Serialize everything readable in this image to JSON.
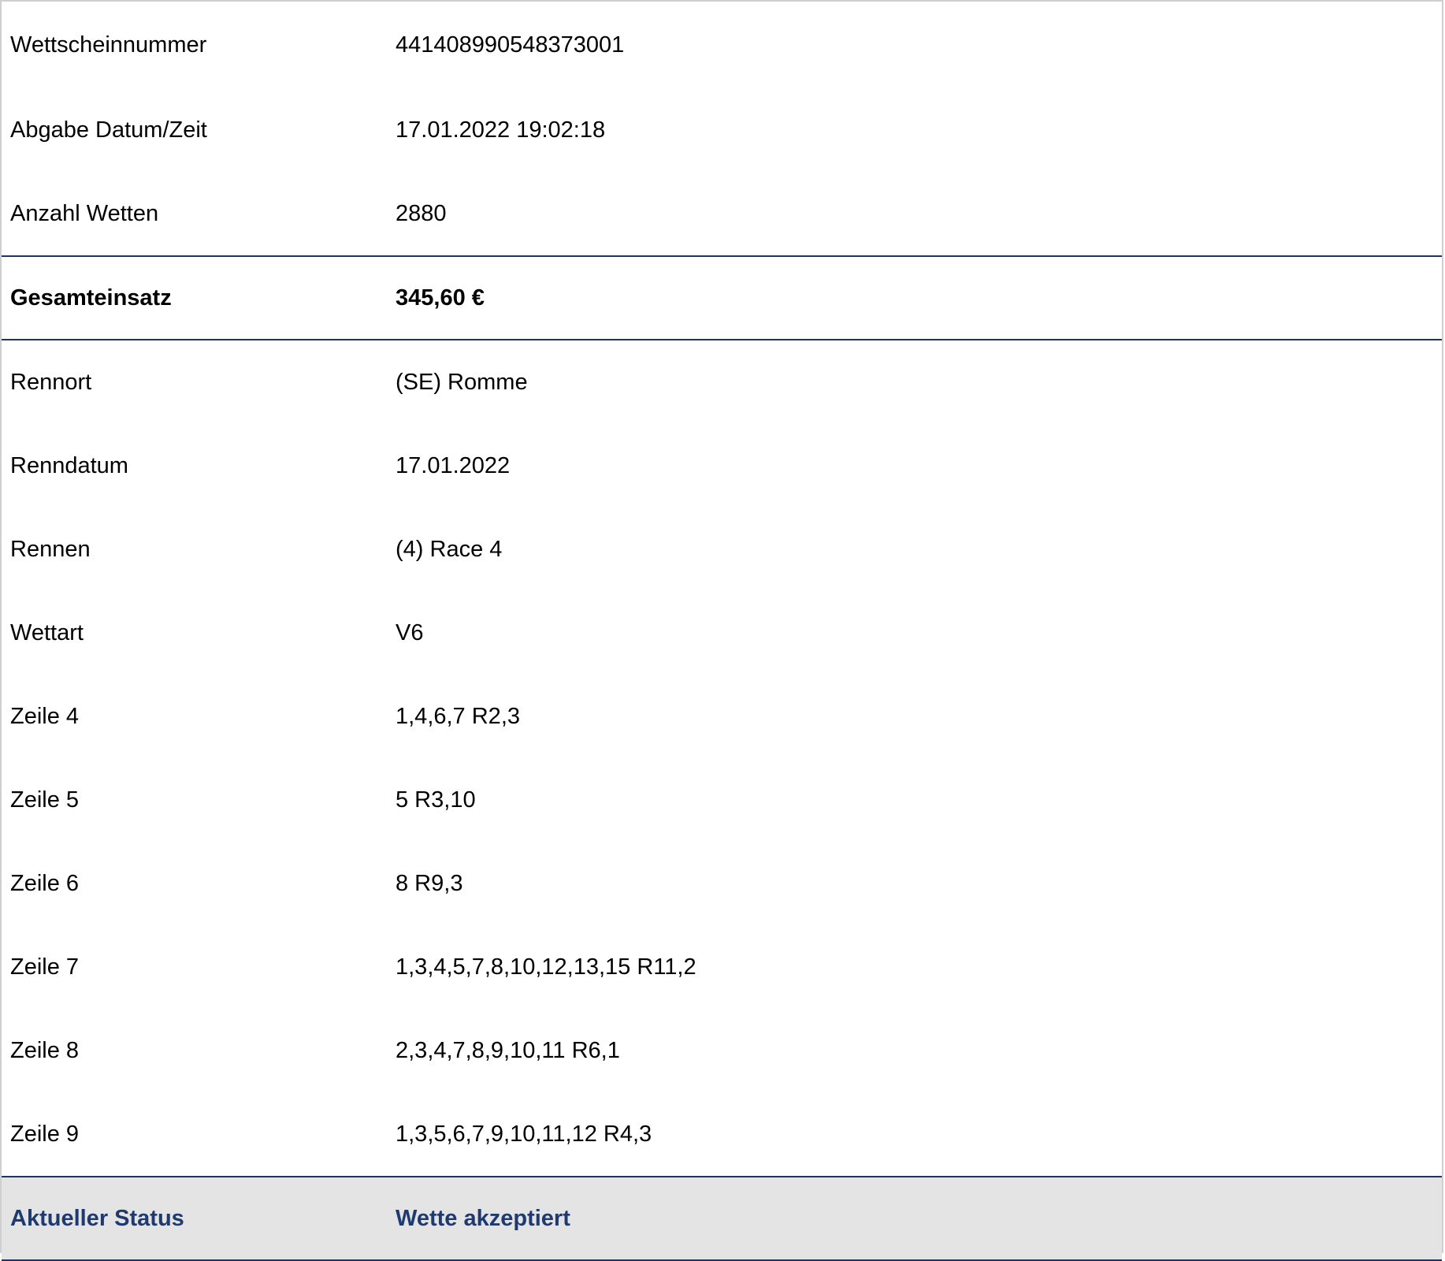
{
  "ticket": {
    "header_rows": [
      {
        "label": "Wettscheinnummer",
        "value": "441408990548373001"
      },
      {
        "label": "Abgabe Datum/Zeit",
        "value": "17.01.2022 19:02:18"
      },
      {
        "label": "Anzahl Wetten",
        "value": "2880"
      }
    ],
    "total": {
      "label": "Gesamteinsatz",
      "value": "345,60 €"
    },
    "detail_rows": [
      {
        "label": "Rennort",
        "value": "(SE) Romme"
      },
      {
        "label": "Renndatum",
        "value": "17.01.2022"
      },
      {
        "label": "Rennen",
        "value": "(4) Race 4"
      },
      {
        "label": "Wettart",
        "value": "V6"
      },
      {
        "label": "Zeile 4",
        "value": "1,4,6,7 R2,3"
      },
      {
        "label": "Zeile 5",
        "value": "5 R3,10"
      },
      {
        "label": "Zeile 6",
        "value": "8 R9,3"
      },
      {
        "label": "Zeile 7",
        "value": "1,3,4,5,7,8,10,12,13,15 R11,2"
      },
      {
        "label": "Zeile 8",
        "value": "2,3,4,7,8,9,10,11 R6,1"
      },
      {
        "label": "Zeile 9",
        "value": "1,3,5,6,7,9,10,11,12 R4,3"
      }
    ],
    "status": {
      "label": "Aktueller Status",
      "value": "Wette akzeptiert"
    }
  },
  "colors": {
    "accent": "#1f3560",
    "status_text": "#1f3a6e",
    "status_background": "#e4e4e4"
  }
}
